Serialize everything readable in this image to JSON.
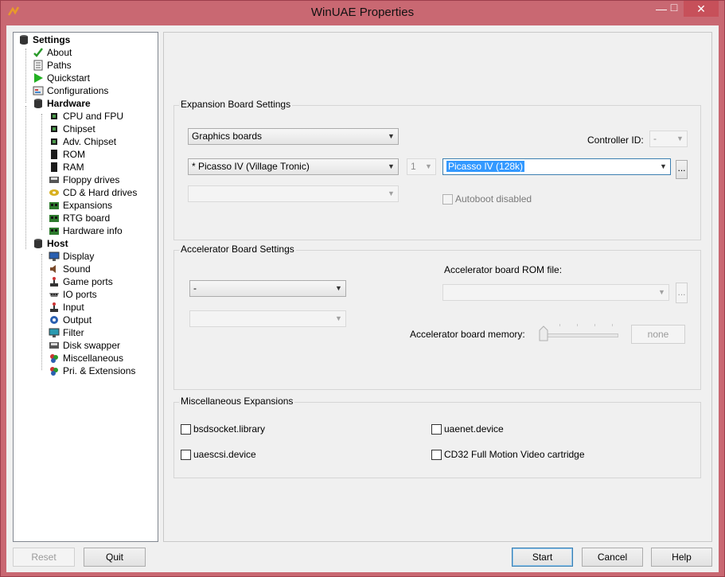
{
  "window": {
    "title": "WinUAE Properties",
    "min_glyph": "—",
    "max_glyph": "□",
    "close_glyph": "✕"
  },
  "tree": {
    "settings": "Settings",
    "items": [
      {
        "label": "About",
        "icon": "checkmark-icon"
      },
      {
        "label": "Paths",
        "icon": "document-icon"
      },
      {
        "label": "Quickstart",
        "icon": "play-icon"
      },
      {
        "label": "Configurations",
        "icon": "config-icon"
      }
    ],
    "hardware": "Hardware",
    "hardware_items": [
      {
        "label": "CPU and FPU",
        "icon": "chip-icon"
      },
      {
        "label": "Chipset",
        "icon": "chip-icon"
      },
      {
        "label": "Adv. Chipset",
        "icon": "chip-icon"
      },
      {
        "label": "ROM",
        "icon": "chip-icon"
      },
      {
        "label": "RAM",
        "icon": "chip-icon"
      },
      {
        "label": "Floppy drives",
        "icon": "floppy-icon"
      },
      {
        "label": "CD & Hard drives",
        "icon": "harddrive-icon"
      },
      {
        "label": "Expansions",
        "icon": "board-icon"
      },
      {
        "label": "RTG board",
        "icon": "board-icon"
      },
      {
        "label": "Hardware info",
        "icon": "board-icon"
      }
    ],
    "host": "Host",
    "host_items": [
      {
        "label": "Display",
        "icon": "monitor-icon"
      },
      {
        "label": "Sound",
        "icon": "speaker-icon"
      },
      {
        "label": "Game ports",
        "icon": "joystick-icon"
      },
      {
        "label": "IO ports",
        "icon": "port-icon"
      },
      {
        "label": "Input",
        "icon": "joystick-icon"
      },
      {
        "label": "Output",
        "icon": "output-icon"
      },
      {
        "label": "Filter",
        "icon": "monitor-icon"
      },
      {
        "label": "Disk swapper",
        "icon": "floppy-icon"
      },
      {
        "label": "Miscellaneous",
        "icon": "misc-icon"
      },
      {
        "label": "Pri. & Extensions",
        "icon": "misc-icon"
      }
    ]
  },
  "expansion": {
    "title": "Expansion Board Settings",
    "type_select": "Graphics boards",
    "controller_label": "Controller ID:",
    "controller_value": "-",
    "board_select": "* Picasso IV (Village Tronic)",
    "num_select": "1",
    "sub_select": "Picasso IV (128k)",
    "browse": "...",
    "autoboot": "Autoboot disabled"
  },
  "accelerator": {
    "title": "Accelerator Board Settings",
    "board_select": "-",
    "rom_label": "Accelerator board ROM file:",
    "browse": "...",
    "memory_label": "Accelerator board memory:",
    "memory_value": "none",
    "memory_slider_fraction": 0
  },
  "misc": {
    "title": "Miscellaneous Expansions",
    "bsdsocket": "bsdsocket.library",
    "uaenet": "uaenet.device",
    "uaescsi": "uaescsi.device",
    "cd32fmv": "CD32 Full Motion Video cartridge"
  },
  "buttons": {
    "reset": "Reset",
    "quit": "Quit",
    "start": "Start",
    "cancel": "Cancel",
    "help": "Help"
  },
  "glyphs": {
    "arrow": "▼"
  }
}
